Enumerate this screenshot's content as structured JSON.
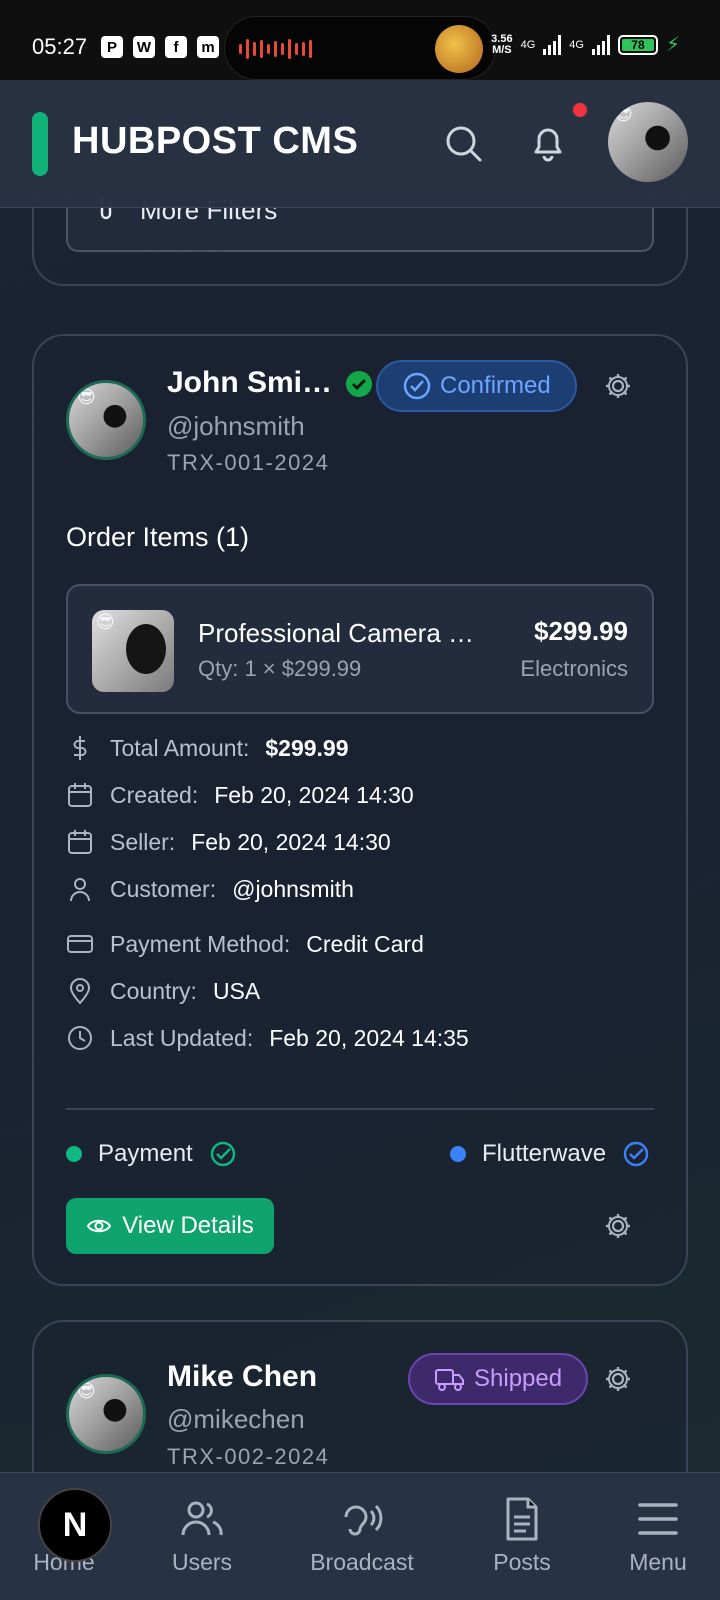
{
  "status_bar": {
    "time": "05:27",
    "apps": [
      "P",
      "W",
      "f",
      "m"
    ],
    "net_speed_value": "3.56",
    "net_speed_unit": "M/S",
    "sim1": "4G",
    "sim2": "4G",
    "battery": "78"
  },
  "header": {
    "title": "HUBPOST CMS",
    "accent_color": "#10b27a",
    "notification_dot_color": "#f2333e"
  },
  "filters": {
    "more_filters_label": "More Filters"
  },
  "orders": [
    {
      "name": "John Smi…",
      "handle": "@johnsmith",
      "trx": "TRX-001-2024",
      "status": "Confirmed",
      "status_color": "#6aa6ff",
      "items_title": "Order Items (1)",
      "items": [
        {
          "name": "Professional Camera Kit",
          "qty_line": "Qty: 1 × $299.99",
          "price": "$299.99",
          "category": "Electronics"
        }
      ],
      "details": {
        "total_label": "Total Amount:",
        "total_value": "$299.99",
        "created_label": "Created:",
        "created_value": "Feb 20, 2024 14:30",
        "seller_label": "Seller:",
        "seller_value": "Feb 20, 2024 14:30",
        "customer_label": "Customer:",
        "customer_value": "@johnsmith",
        "payment_label": "Payment Method:",
        "payment_value": "Credit Card",
        "country_label": "Country:",
        "country_value": "USA",
        "updated_label": "Last Updated:",
        "updated_value": "Feb 20, 2024 14:35"
      },
      "gateways": {
        "payment_label": "Payment",
        "payment_color": "#10b981",
        "provider_label": "Flutterwave",
        "provider_color": "#3b82f6"
      },
      "view_details_label": "View Details"
    },
    {
      "name": "Mike Chen",
      "handle": "@mikechen",
      "trx": "TRX-002-2024",
      "status": "Shipped",
      "status_color": "#c79bff"
    }
  ],
  "bottom_nav": {
    "badge": "N",
    "items": [
      {
        "label": "Home",
        "icon": "home-icon"
      },
      {
        "label": "Users",
        "icon": "users-icon"
      },
      {
        "label": "Broadcast",
        "icon": "broadcast-icon"
      },
      {
        "label": "Posts",
        "icon": "posts-icon"
      },
      {
        "label": "Menu",
        "icon": "menu-icon"
      }
    ]
  }
}
